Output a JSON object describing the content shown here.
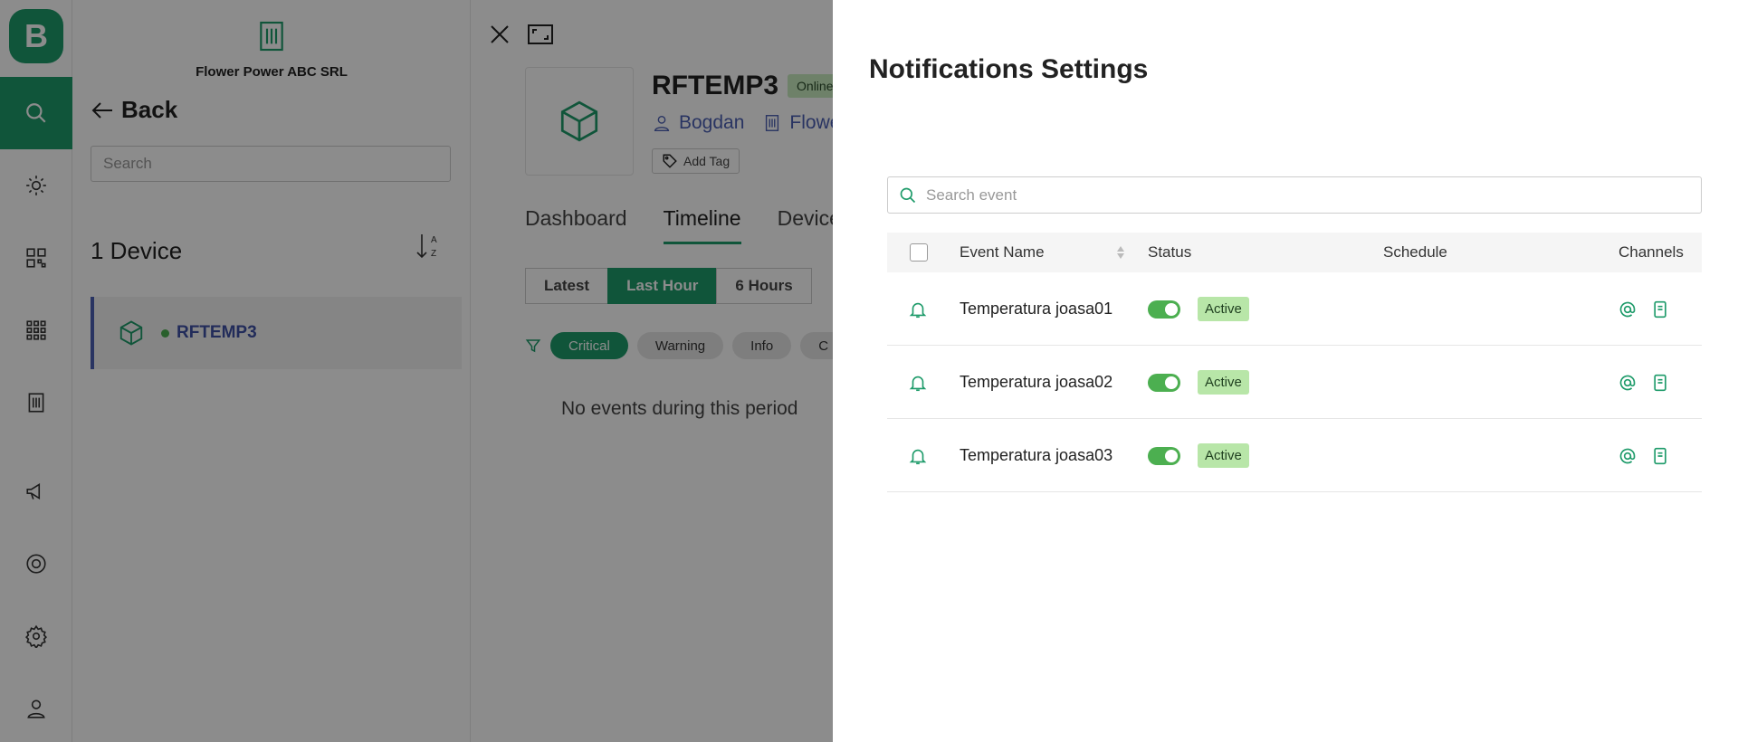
{
  "app": {
    "logo_letter": "B",
    "org_name": "Flower Power ABC SRL"
  },
  "rail": {
    "icons": [
      "search-icon",
      "light-icon",
      "qr-icon",
      "apps-icon",
      "building-icon",
      "megaphone-icon",
      "support-icon",
      "settings-icon",
      "user-icon"
    ],
    "active": "search-icon"
  },
  "device_list": {
    "back_label": "Back",
    "search_placeholder": "Search",
    "count_label": "1 Device",
    "devices": [
      {
        "name": "RFTEMP3",
        "status": "online"
      }
    ]
  },
  "device_detail": {
    "name": "RFTEMP3",
    "status_badge": "Online",
    "owner": "Bogdan",
    "location": "Flowe",
    "add_tag_label": "Add Tag",
    "tabs": [
      "Dashboard",
      "Timeline",
      "Device"
    ],
    "active_tab": "Timeline",
    "ranges": [
      "Latest",
      "Last Hour",
      "6 Hours"
    ],
    "active_range": "Last Hour",
    "severities": [
      "Critical",
      "Warning",
      "Info",
      "C"
    ],
    "active_severity": "Critical",
    "empty_message": "No events during this period"
  },
  "notifications": {
    "title": "Notifications Settings",
    "search_placeholder": "Search event",
    "columns": {
      "event_name": "Event Name",
      "status": "Status",
      "schedule": "Schedule",
      "channels": "Channels"
    },
    "rows": [
      {
        "name": "Temperatura joasa01",
        "enabled": true,
        "status": "Active",
        "schedule": ""
      },
      {
        "name": "Temperatura joasa02",
        "enabled": true,
        "status": "Active",
        "schedule": ""
      },
      {
        "name": "Temperatura joasa03",
        "enabled": true,
        "status": "Active",
        "schedule": ""
      }
    ]
  },
  "colors": {
    "accent": "#1e9b6a",
    "link": "#4b5fb3",
    "toggle_on": "#4caf50",
    "active_badge": "#b8e6a8"
  }
}
